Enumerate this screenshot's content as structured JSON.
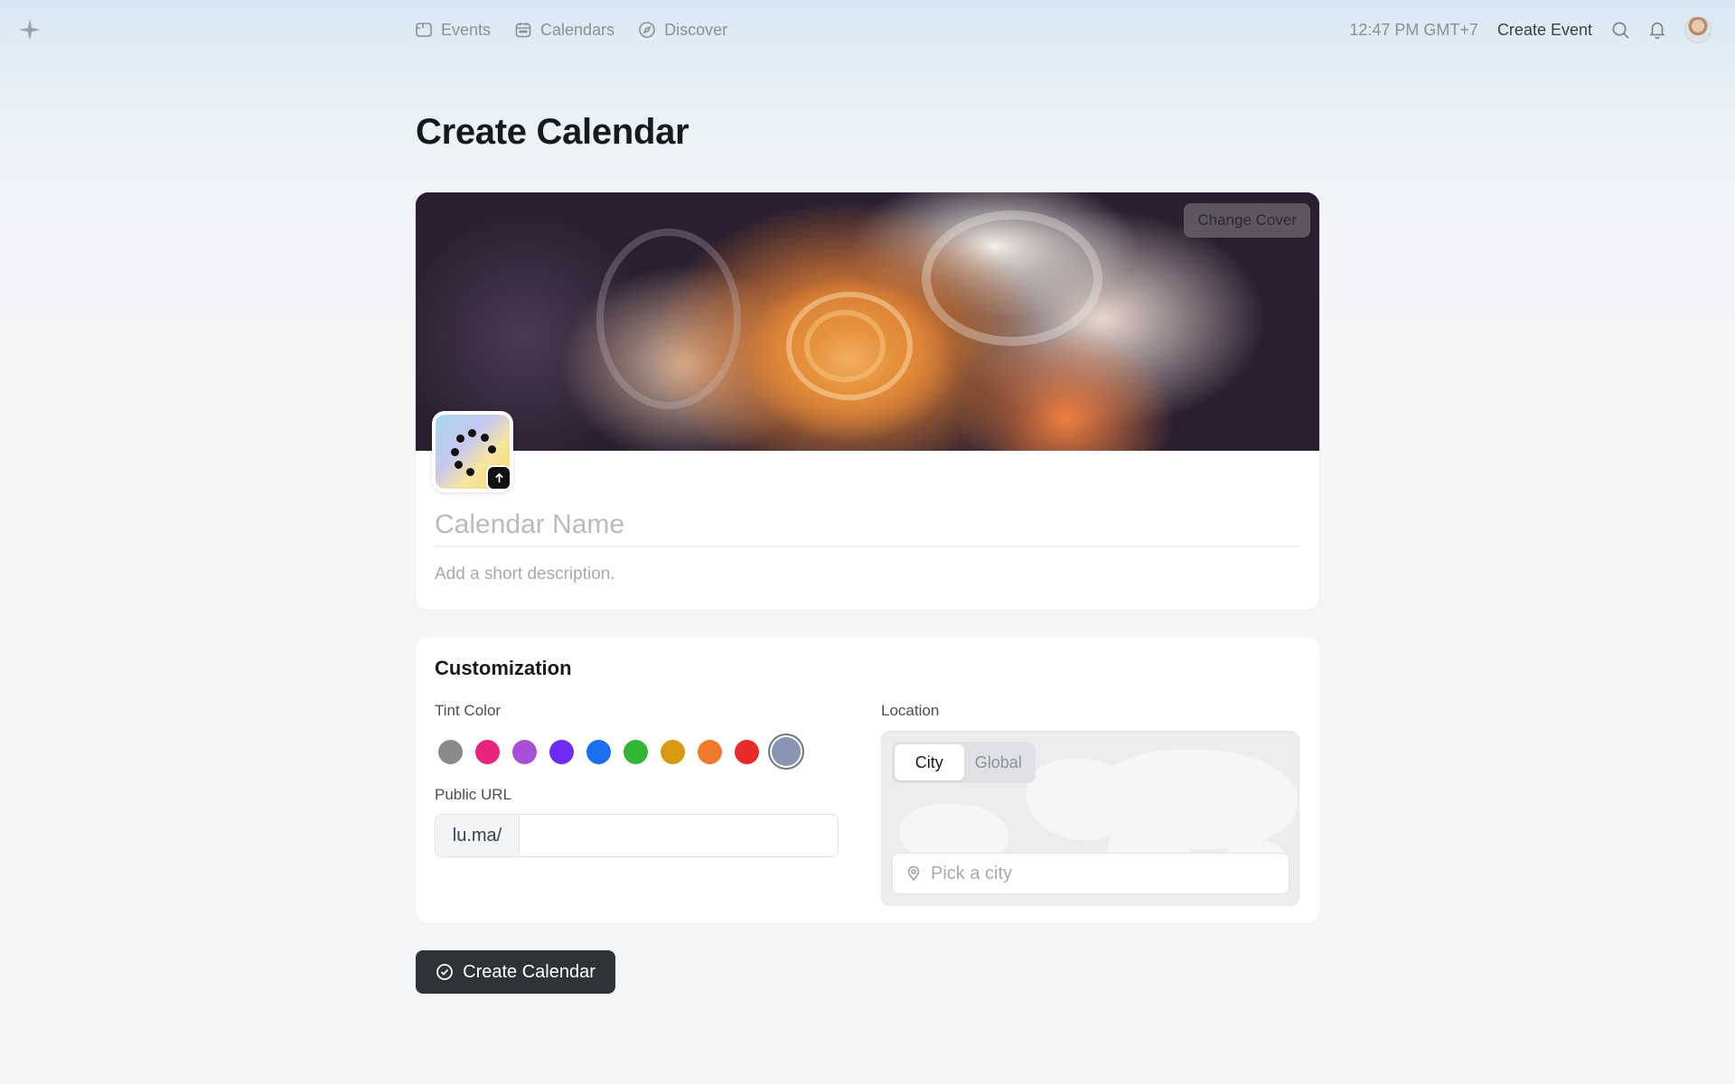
{
  "nav": {
    "items": [
      {
        "label": "Events",
        "icon": "ticket-icon"
      },
      {
        "label": "Calendars",
        "icon": "calendar-icon"
      },
      {
        "label": "Discover",
        "icon": "compass-icon"
      }
    ],
    "time": "12:47 PM GMT+7",
    "create_event": "Create Event"
  },
  "page": {
    "title": "Create Calendar"
  },
  "cover": {
    "change_cover": "Change Cover"
  },
  "form": {
    "name_placeholder": "Calendar Name",
    "description_placeholder": "Add a short description."
  },
  "customization": {
    "title": "Customization",
    "tint_label": "Tint Color",
    "tint_colors": [
      "#8a8a8a",
      "#e9247a",
      "#a94ed8",
      "#6c2cf5",
      "#1a6ef0",
      "#33b536",
      "#d99a12",
      "#f07a2c",
      "#e82a2a",
      "#8795b3"
    ],
    "selected_tint_index": 9,
    "url_label": "Public URL",
    "url_prefix": "lu.ma/",
    "url_value": "",
    "location_label": "Location",
    "location_tabs": [
      "City",
      "Global"
    ],
    "active_location_tab": "City",
    "city_placeholder": "Pick a city"
  },
  "actions": {
    "create_calendar": "Create Calendar"
  }
}
